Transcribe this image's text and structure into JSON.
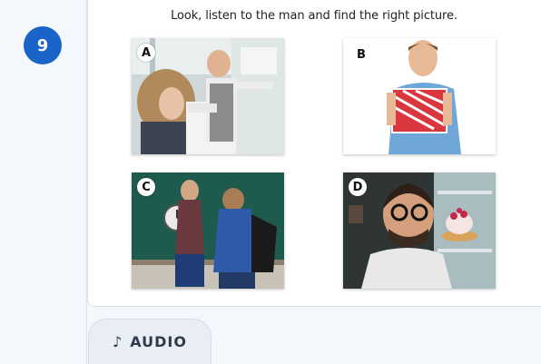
{
  "question": {
    "number": "9",
    "prompt": "Look, listen to the man and find the right picture."
  },
  "options": [
    {
      "letter": "A",
      "icon": "man-cooking-photo"
    },
    {
      "letter": "B",
      "icon": "man-with-gift-photo"
    },
    {
      "letter": "C",
      "icon": "teacher-with-clock-photo"
    },
    {
      "letter": "D",
      "icon": "man-looking-at-cake-photo"
    }
  ],
  "audio": {
    "label": "AUDIO",
    "icon": "music-note-icon",
    "glyph": "♪"
  },
  "colors": {
    "badge": "#1a63c8",
    "panel": "#f4f7fc"
  }
}
